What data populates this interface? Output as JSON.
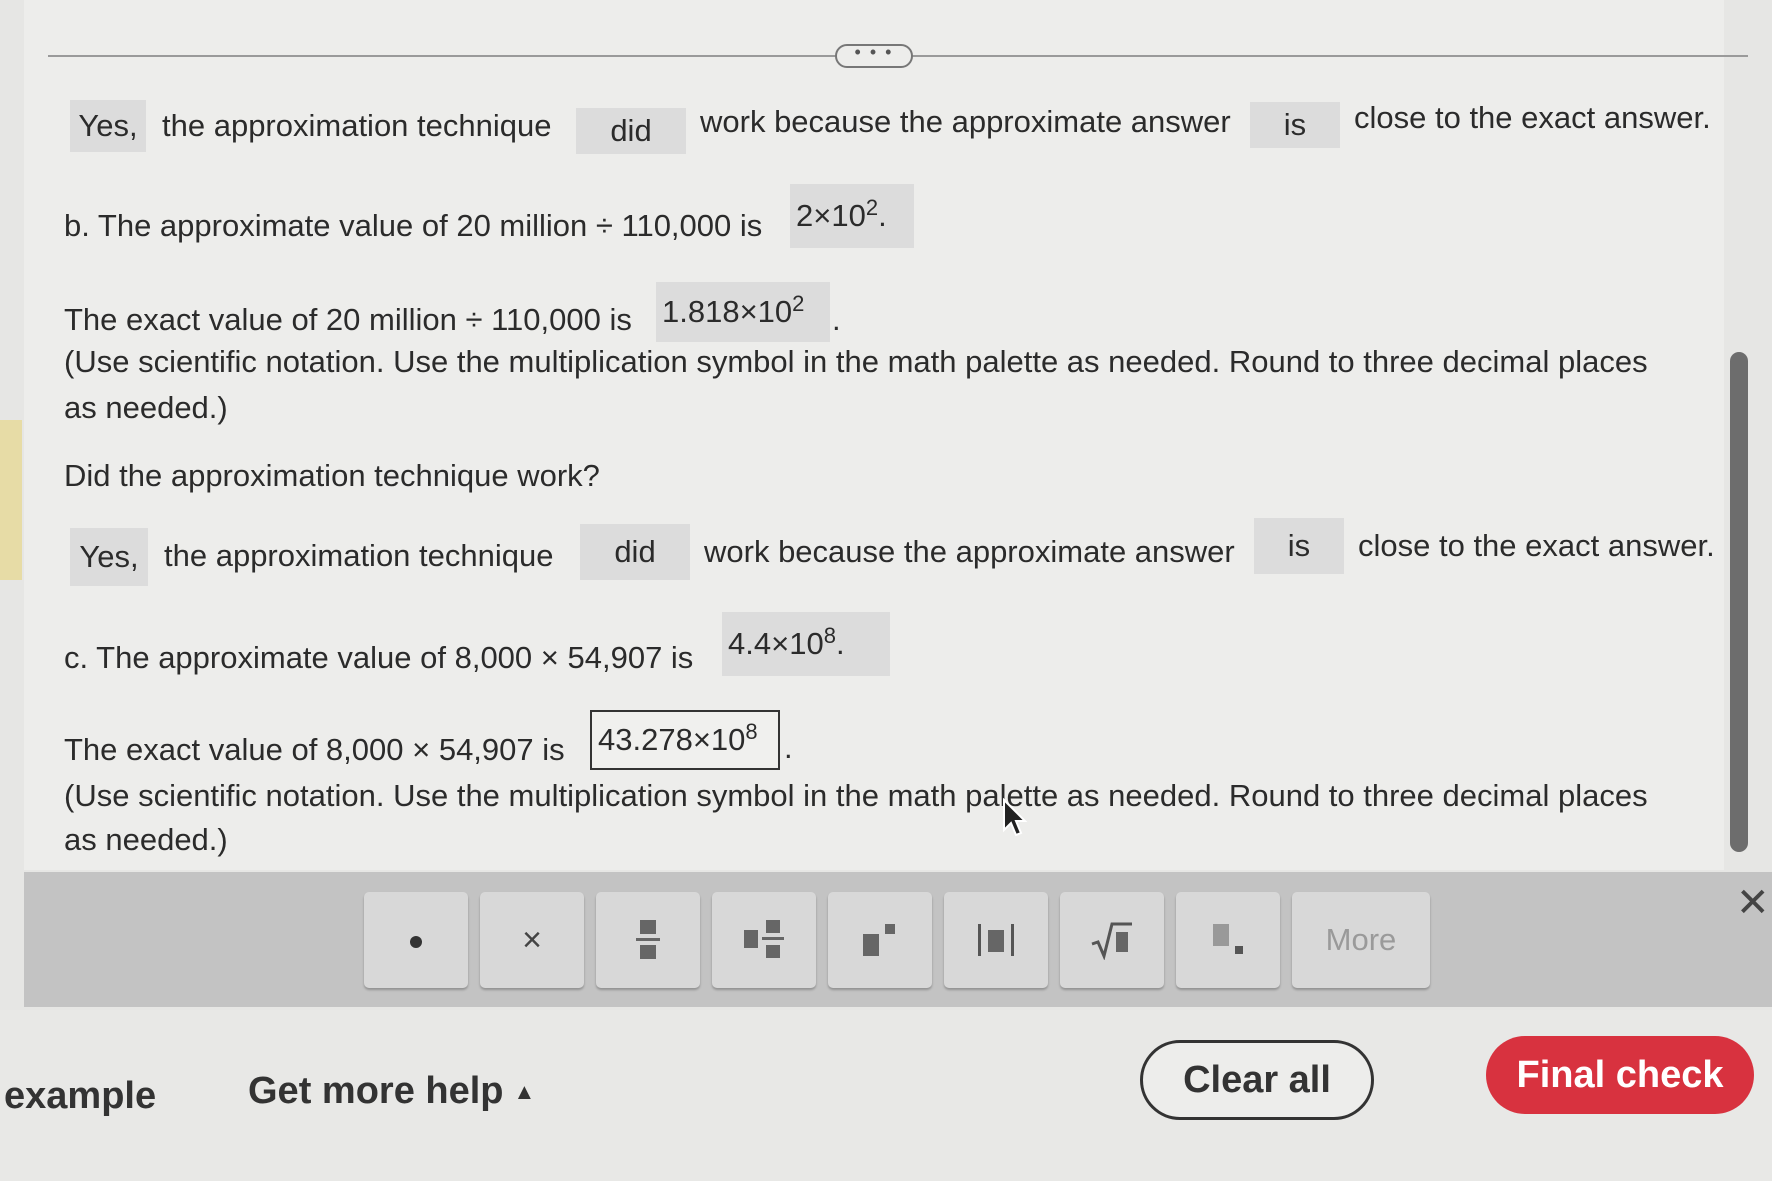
{
  "section_a": {
    "chip_yes": "Yes,",
    "text_technique": "the approximation technique",
    "chip_did": "did",
    "text_work": "work because the approximate answer",
    "chip_is": "is",
    "text_close": "close to the exact answer."
  },
  "section_b": {
    "approx_prompt": "b. The approximate value of 20 million ÷ 110,000 is",
    "approx_base": "2×10",
    "approx_exp": "2",
    "exact_prompt": "The exact value of 20 million ÷ 110,000 is",
    "exact_base": "1.818×10",
    "exact_exp": "2",
    "instruction_line1": "(Use scientific notation. Use the multiplication symbol in the math palette as needed. Round to three decimal places",
    "instruction_line2": "as needed.)",
    "question": "Did the approximation technique work?",
    "chip_yes": "Yes,",
    "text_technique": "the approximation technique",
    "chip_did": "did",
    "text_work": "work because the approximate answer",
    "chip_is": "is",
    "text_close": "close to the exact answer."
  },
  "section_c": {
    "approx_prompt": "c. The approximate value of 8,000 × 54,907 is",
    "approx_base": "4.4×10",
    "approx_exp": "8",
    "exact_prompt": "The exact value of 8,000 × 54,907 is",
    "exact_base": "43.278×10",
    "exact_exp": "8",
    "instruction_line1": "(Use scientific notation. Use the multiplication symbol in the math palette as needed. Round to three decimal places",
    "instruction_line2": "as needed.)"
  },
  "toolbar": {
    "buttons": [
      "dot-icon",
      "times-icon",
      "fraction-icon",
      "mixed-number-icon",
      "exponent-icon",
      "absolute-value-icon",
      "square-root-icon",
      "subscript-icon"
    ],
    "times_symbol": "×",
    "more_label": "More",
    "close_symbol": "✕"
  },
  "footer": {
    "example_label": "example",
    "help_label": "Get more help",
    "help_caret": "▲",
    "clear_label": "Clear all",
    "final_label": "Final check"
  },
  "colors": {
    "final_button": "#d8323f",
    "chip_bg": "#dcdcdc",
    "toolbar_bg": "#c3c3c3"
  }
}
